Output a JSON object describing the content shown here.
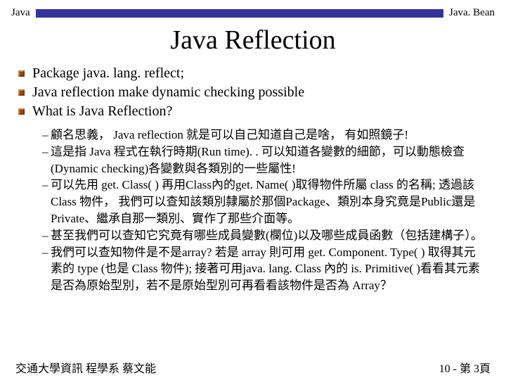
{
  "header": {
    "left_label": "Java",
    "right_label": "Java. Bean"
  },
  "title": "Java Reflection",
  "bullets": {
    "items": [
      "Package  java. lang. reflect;",
      "Java reflection make dynamic checking possible",
      "What is Java Reflection?"
    ]
  },
  "subbullets": {
    "items": [
      "顧名思義， Java reflection 就是可以自己知道自己是啥， 有如照鏡子!",
      "這是指 Java 程式在執行時期(Run time). . 可以知道各變數的細節，可以動態檢查 (Dynamic checking)各變數與各類別的一些屬性!",
      "可以先用 get. Class( ) 再用Class內的get. Name( )取得物件所屬 class 的名稱; 透過該 Class 物件， 我們可以查知該類別隸屬於那個Package、類別本身究竟是Public還是Private、繼承自那一類別、實作了那些介面等。",
      "甚至我們可以查知它究竟有哪些成員變數(欄位)以及哪些成員函數（包括建構子）。",
      "我們可以查知物件是不是array? 若是 array 則可用 get. Component. Type( ) 取得其元素的 type (也是 Class 物件); 接著可用java. lang. Class 內的 is. Primitive( )看看其元素是否為原始型別，若不是原始型別可再看看該物件是否為 Array？"
    ]
  },
  "footer": {
    "left": "交通大學資訊 程學系  蔡文能",
    "right": "10 - 第 3頁"
  }
}
